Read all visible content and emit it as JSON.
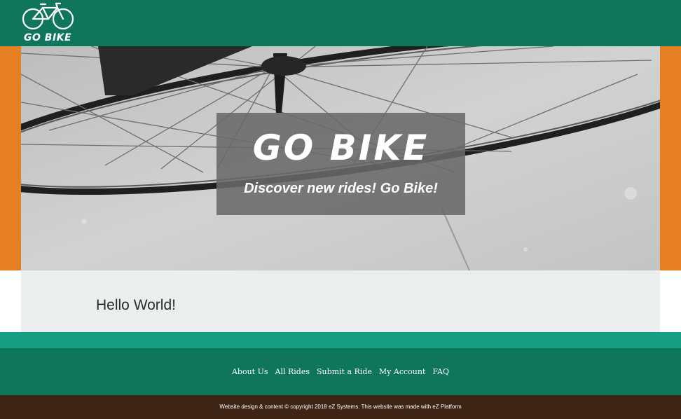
{
  "header": {
    "logo_text": "GO BIKE",
    "logo_icon": "bicycle-icon"
  },
  "hero": {
    "title": "GO BIKE",
    "subtitle": "Discover new rides! Go Bike!"
  },
  "main": {
    "title": "Hello World!"
  },
  "footer": {
    "nav": [
      {
        "label": "About Us"
      },
      {
        "label": "All Rides"
      },
      {
        "label": "Submit a Ride"
      },
      {
        "label": "My Account"
      },
      {
        "label": "FAQ"
      }
    ],
    "copyright": "Website design & content © copyright 2018 eZ Systems. This website was made with eZ Platform"
  },
  "colors": {
    "header_green": "#10755d",
    "accent_orange": "#e57f21",
    "accent_teal": "#159e81",
    "content_bg": "#ebeeef",
    "copyright_brown": "#3d2414"
  }
}
